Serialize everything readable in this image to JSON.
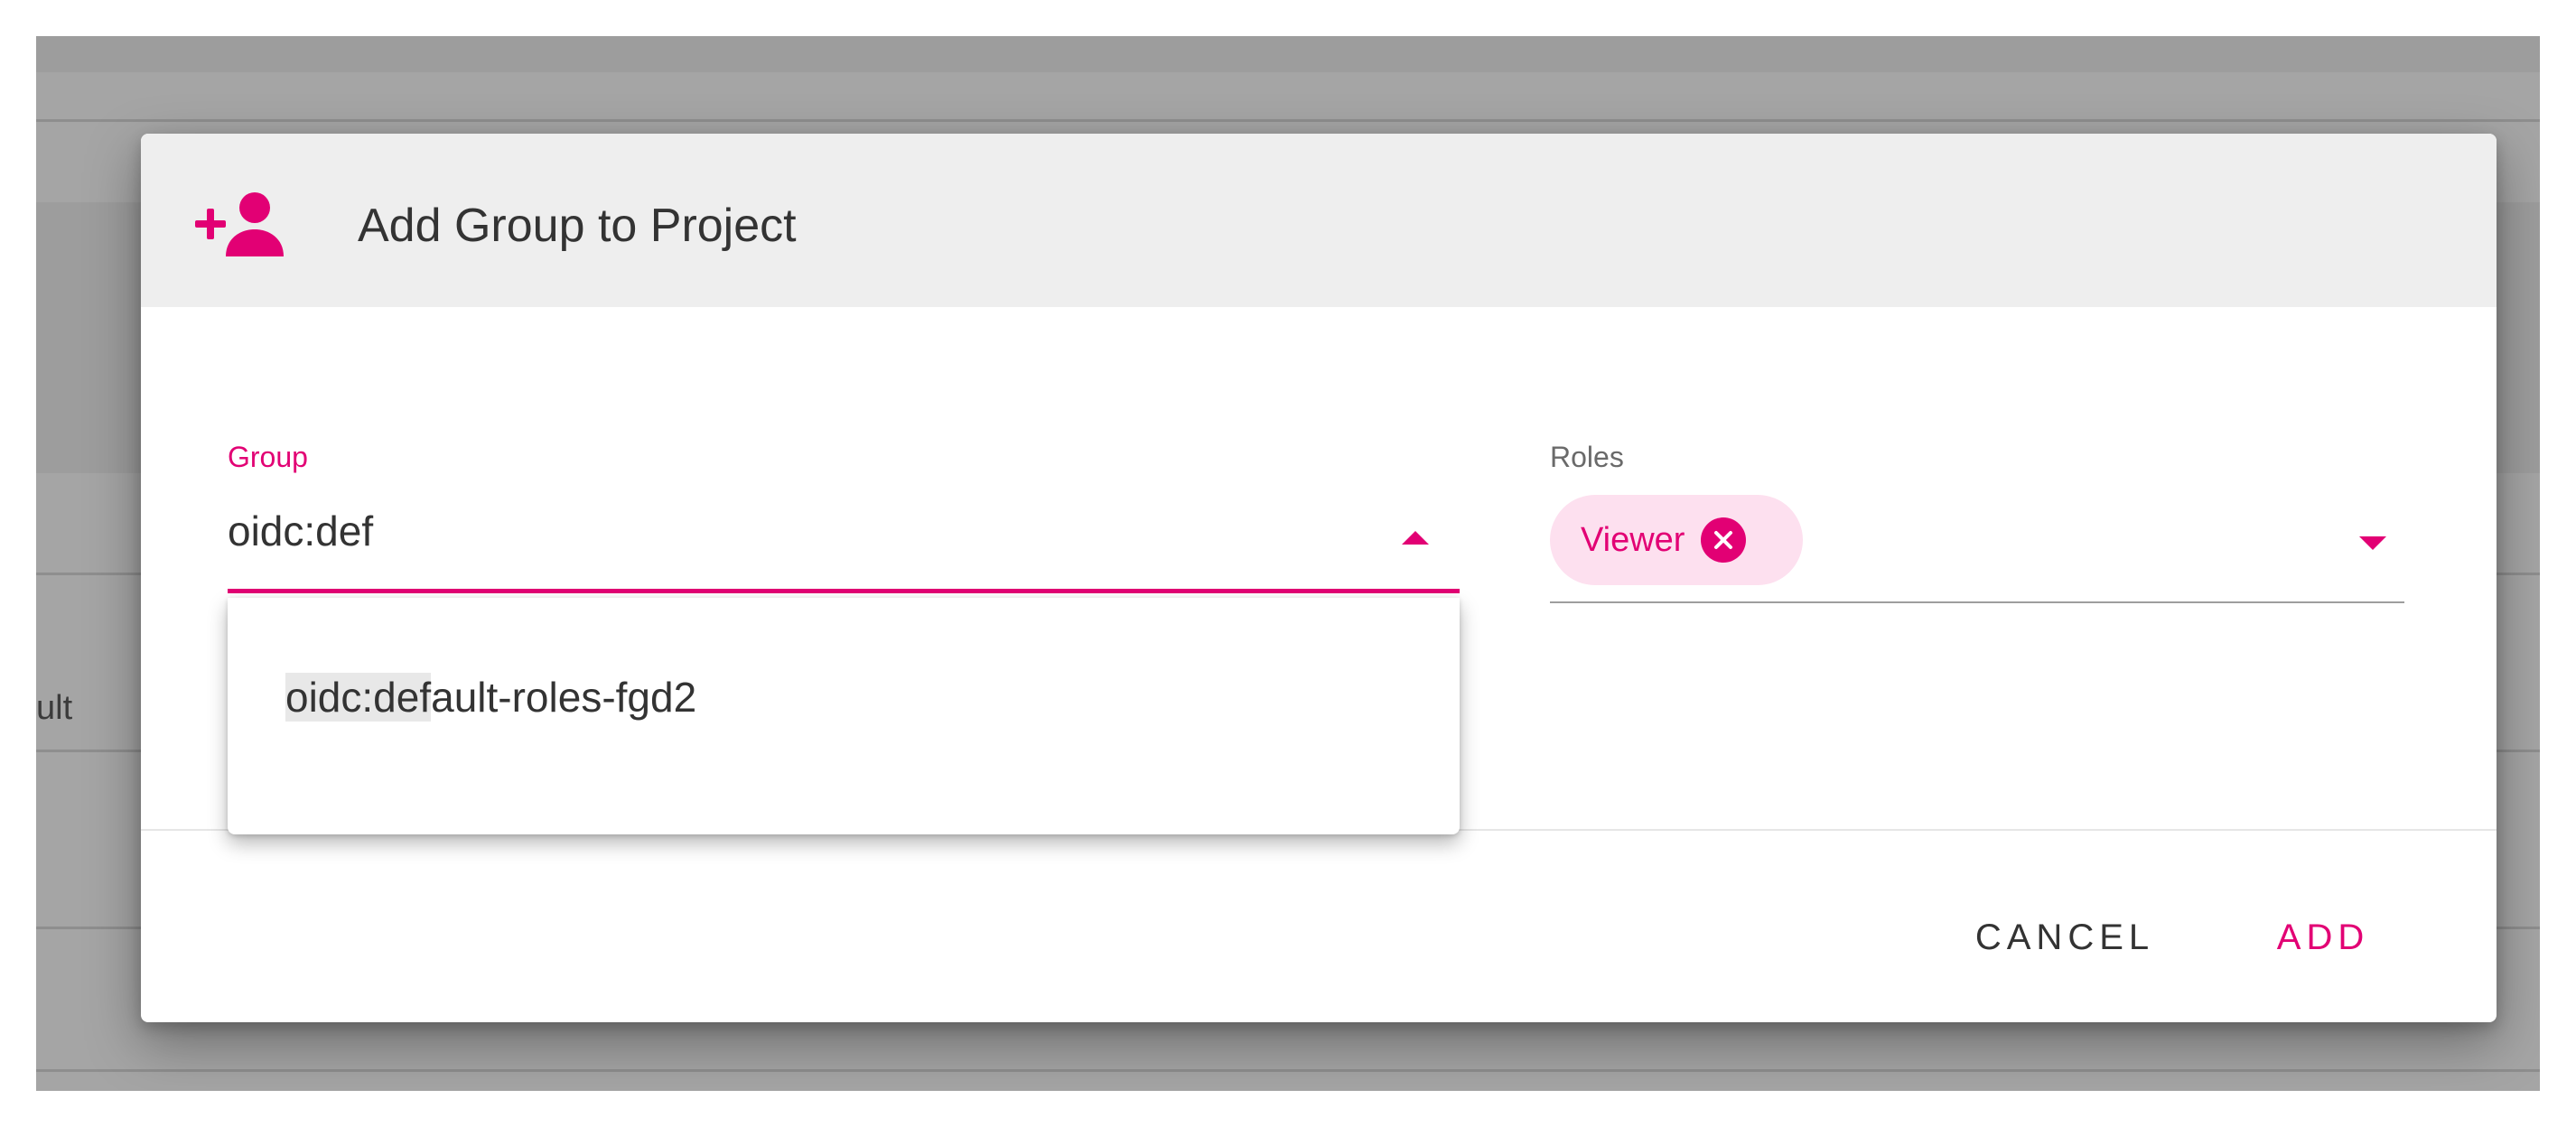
{
  "background": {
    "partial_text": "ult"
  },
  "dialog": {
    "title": "Add Group to Project",
    "header_icon": "person-add-icon",
    "group_field": {
      "label": "Group",
      "value": "oidc:def",
      "expanded": true
    },
    "autocomplete": {
      "options": [
        {
          "match": "oidc:def",
          "rest": "ault-roles-fgd2"
        }
      ]
    },
    "roles_field": {
      "label": "Roles",
      "chips": [
        {
          "label": "Viewer"
        }
      ]
    },
    "actions": {
      "cancel_label": "CANCEL",
      "add_label": "ADD"
    }
  },
  "colors": {
    "accent": "#e20074",
    "chip_bg": "#fde0ef",
    "backdrop": "#a5a5a5",
    "header_bg": "#eeeeee"
  }
}
